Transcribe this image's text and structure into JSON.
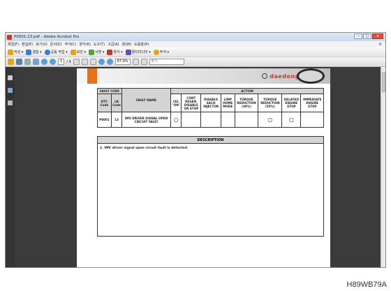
{
  "window": {
    "title": "P0001-13.pdf - Adobe Acrobat Pro",
    "min_label": "─",
    "max_label": "□",
    "close_label": "✕"
  },
  "menubar": {
    "items": [
      "파일(F)",
      "편집(E)",
      "보기(V)",
      "문서(D)",
      "주석(C)",
      "양식(R)",
      "도구(T)",
      "고급(A)",
      "창(W)",
      "도움말(H)"
    ],
    "close_label": "×"
  },
  "toolbar1": {
    "items": [
      {
        "label": "작성 ▾",
        "icon": "create-icon",
        "color": "#e3a51a"
      },
      {
        "label": "결합 ▾",
        "icon": "combine-icon",
        "color": "#3a7bd5"
      },
      {
        "label": "공동 작업 ▾",
        "icon": "collaborate-icon",
        "color": "#3a7bd5"
      },
      {
        "label": "보안 ▾",
        "icon": "lock-icon",
        "color": "#e3a51a"
      },
      {
        "label": "서명 ▾",
        "icon": "sign-icon",
        "color": "#5a9e3a"
      },
      {
        "label": "양식 ▾",
        "icon": "form-icon",
        "color": "#c0392b"
      },
      {
        "label": "멀티미디어 ▾",
        "icon": "multimedia-icon",
        "color": "#6a4ab5"
      },
      {
        "label": "주석 ▾",
        "icon": "comment-icon",
        "color": "#e3a51a"
      }
    ]
  },
  "toolbar2": {
    "page_current": "1",
    "page_total": "/ 3",
    "zoom": "67.9%",
    "search_placeholder": "찾기"
  },
  "document": {
    "brand": "daedong",
    "fault_table": {
      "fault_code_header": "FAULT CODE",
      "dtc_header": "DTC Code",
      "lb_header": "LB Code",
      "fault_name_header": "FAULT NAME",
      "action_header": "ACTION",
      "action_columns": [
        "CEL \"ON\"",
        "CONT REGEN. DISABLE OR STOP",
        "DISABLE EACH INJECTOR",
        "LIMP HOME MODE",
        "TORQUE REDUCTION (30%)",
        "TORQUE REDUCTION (50%)",
        "DELAYED ENGINE STOP",
        "IMMEDIATE ENGINE STOP"
      ],
      "row": {
        "dtc": "P0001",
        "lb": "13",
        "fault_name": "IMV DRIVER SIGNAL OPEN CIRCUIT FAULT",
        "marks": [
          "○",
          "",
          "",
          "",
          "",
          "○",
          "○",
          ""
        ]
      }
    },
    "description_header": "DESCRIPTION",
    "description_text": "1.  IMV driver signal open circuit fault is detected."
  },
  "figure_label": "H89WB79A"
}
